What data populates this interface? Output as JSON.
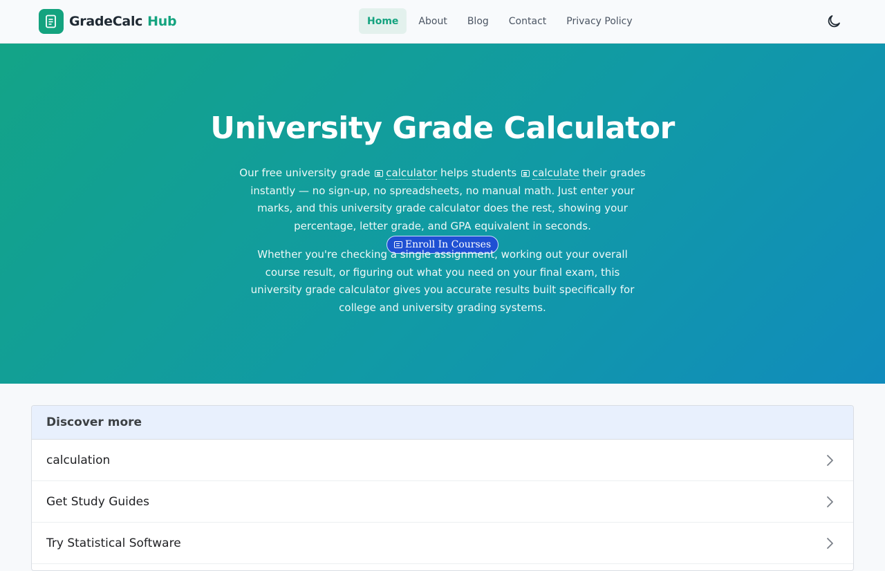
{
  "header": {
    "logo_text": "GradeCalc",
    "logo_accent": "Hub",
    "nav": [
      {
        "label": "Home",
        "active": true
      },
      {
        "label": "About",
        "active": false
      },
      {
        "label": "Blog",
        "active": false
      },
      {
        "label": "Contact",
        "active": false
      },
      {
        "label": "Privacy Policy",
        "active": false
      }
    ],
    "theme_icon": "moon-icon"
  },
  "hero": {
    "title": "University Grade Calculator",
    "p1": {
      "t1": "Our free university grade ",
      "link1": "calculator",
      "t2": " helps students ",
      "link2": "calculate",
      "t3": " their grades instantly — no sign-up, no spreadsheets, no manual math. Just enter your marks, and this university grade calculator does the rest, showing your percentage, letter grade, and GPA equivalent in seconds.",
      "enroll_label": "Enroll In Courses"
    },
    "p2": "Whether you're checking a single assignment, working out your overall course result, or figuring out what you need on your final exam, this university grade calculator gives you accurate results built specifically for college and university grading systems."
  },
  "discover": {
    "title": "Discover more",
    "items": [
      {
        "label": "calculation"
      },
      {
        "label": "Get Study Guides"
      },
      {
        "label": "Try Statistical Software"
      }
    ]
  },
  "colors": {
    "brand": "#14a37f",
    "hero_start": "#13a487",
    "hero_end": "#118cbc",
    "enroll_pill": "#1f50d3"
  }
}
